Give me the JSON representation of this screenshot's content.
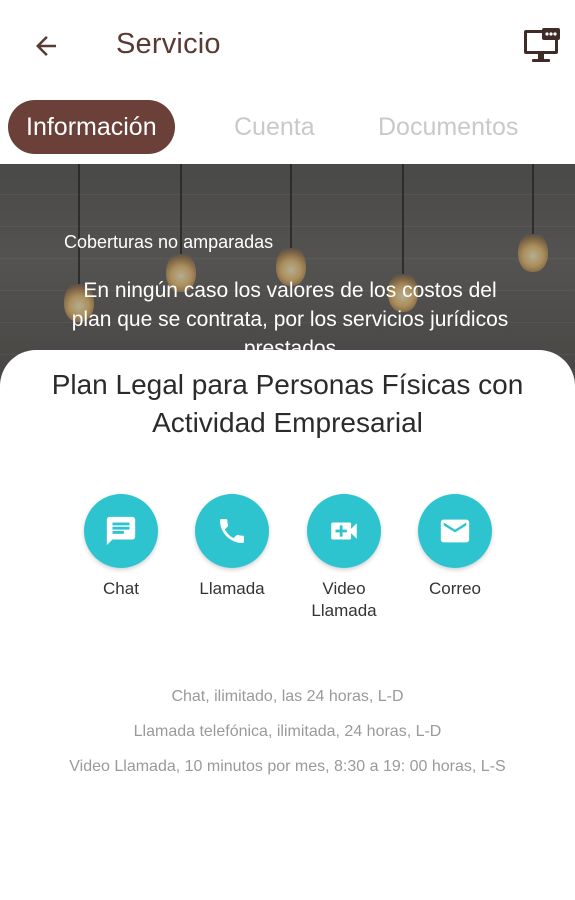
{
  "header": {
    "title": "Servicio",
    "back_icon": "arrow-left-icon",
    "right_icon": "monitor-chat-icon"
  },
  "tabs": [
    {
      "label": "Información",
      "active": true
    },
    {
      "label": "Cuenta",
      "active": false
    },
    {
      "label": "Documentos",
      "active": false
    }
  ],
  "hero": {
    "subtitle": "Coberturas no amparadas",
    "body": "En ningún caso los valores de los costos del plan que se contrata, por los servicios jurídicos prestados"
  },
  "plan": {
    "title": "Plan Legal para Personas Físicas con Actividad Empresarial"
  },
  "actions": [
    {
      "label": "Chat",
      "icon": "chat-icon"
    },
    {
      "label": "Llamada",
      "icon": "phone-icon"
    },
    {
      "label": "Video\nLlamada",
      "icon": "video-call-icon"
    },
    {
      "label": "Correo",
      "icon": "mail-icon"
    }
  ],
  "info_lines": [
    "Chat, ilimitado, las 24 horas, L-D",
    "Llamada telefónica, ilimitada, 24 horas, L-D",
    "Video Llamada, 10 minutos por mes,  8:30 a 19: 00 horas, L-S"
  ],
  "colors": {
    "accent_brown": "#6b4039",
    "title_brown": "#5a3b33",
    "action_teal": "#2ec4cf"
  }
}
